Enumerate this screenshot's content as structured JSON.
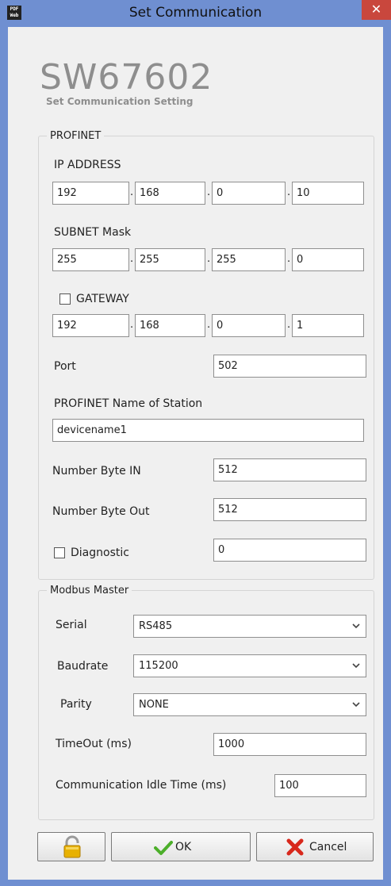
{
  "window": {
    "title": "Set Communication",
    "app_icon_text": "PDF\nWeb"
  },
  "header": {
    "product": "SW67602",
    "subtitle": "Set Communication Setting"
  },
  "profinet": {
    "legend": "PROFINET",
    "ip_label": "IP ADDRESS",
    "ip": [
      "192",
      "168",
      "0",
      "10"
    ],
    "subnet_label": "SUBNET Mask",
    "subnet": [
      "255",
      "255",
      "255",
      "0"
    ],
    "gateway_label": "GATEWAY",
    "gateway_checked": false,
    "gateway": [
      "192",
      "168",
      "0",
      "1"
    ],
    "port_label": "Port",
    "port": "502",
    "station_label": "PROFINET Name of Station",
    "station": "devicename1",
    "byte_in_label": "Number Byte IN",
    "byte_in": "512",
    "byte_out_label": "Number Byte Out",
    "byte_out": "512",
    "diagnostic_label": "Diagnostic",
    "diagnostic_checked": false,
    "diagnostic": "0"
  },
  "modbus": {
    "legend": "Modbus Master",
    "serial_label": "Serial",
    "serial": "RS485",
    "baud_label": "Baudrate",
    "baud": "115200",
    "parity_label": "Parity",
    "parity": "NONE",
    "timeout_label": "TimeOut (ms)",
    "timeout": "1000",
    "idle_label": "Communication Idle Time (ms)",
    "idle": "100"
  },
  "buttons": {
    "ok": "OK",
    "cancel": "Cancel",
    "lock_icon": "padlock-icon"
  },
  "colors": {
    "titlebar": "#6f8fd1",
    "close": "#c9473d",
    "brand": "#8e8e8e"
  }
}
